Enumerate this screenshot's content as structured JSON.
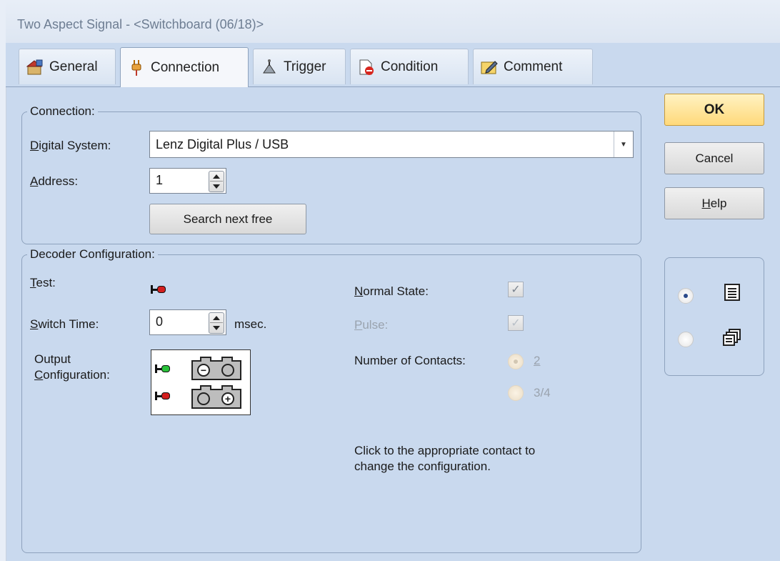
{
  "window": {
    "title": "Two Aspect Signal - <Switchboard (06/18)>"
  },
  "tabs": [
    {
      "label": "General",
      "icon": "general-icon"
    },
    {
      "label": "Connection",
      "icon": "connection-plug-icon"
    },
    {
      "label": "Trigger",
      "icon": "trigger-icon"
    },
    {
      "label": "Condition",
      "icon": "condition-icon"
    },
    {
      "label": "Comment",
      "icon": "comment-icon"
    }
  ],
  "connection": {
    "group_label": "Connection:",
    "digital_system_label": "Digital System:",
    "digital_system_value": "Lenz Digital Plus / USB",
    "address_label": "Address:",
    "address_value": "1",
    "search_button": "Search next free"
  },
  "decoder": {
    "group_label": "Decoder Configuration:",
    "test_label": "Test:",
    "switch_time_label": "Switch Time:",
    "switch_time_value": "0",
    "switch_time_unit": "msec.",
    "output_label_1": "Output",
    "output_label_2": "Configuration:",
    "normal_state_label": "Normal State:",
    "normal_state_checked": true,
    "pulse_label": "Pulse:",
    "pulse_checked": true,
    "contacts_label": "Number of Contacts:",
    "contacts_option_1": "2",
    "contacts_option_2": "3/4",
    "contacts_selected": "2",
    "hint_line_1": "Click to the appropriate contact to",
    "hint_line_2": "change the configuration."
  },
  "buttons": {
    "ok": "OK",
    "cancel": "Cancel",
    "help": "Help"
  },
  "view_mode": {
    "selected": "list",
    "options": [
      "list-view-icon",
      "multi-window-icon"
    ]
  },
  "colors": {
    "signal_red": "#d41f1f",
    "signal_green": "#29c23a",
    "ok_button": "#ffd97a",
    "background": "#c9d9ee"
  }
}
